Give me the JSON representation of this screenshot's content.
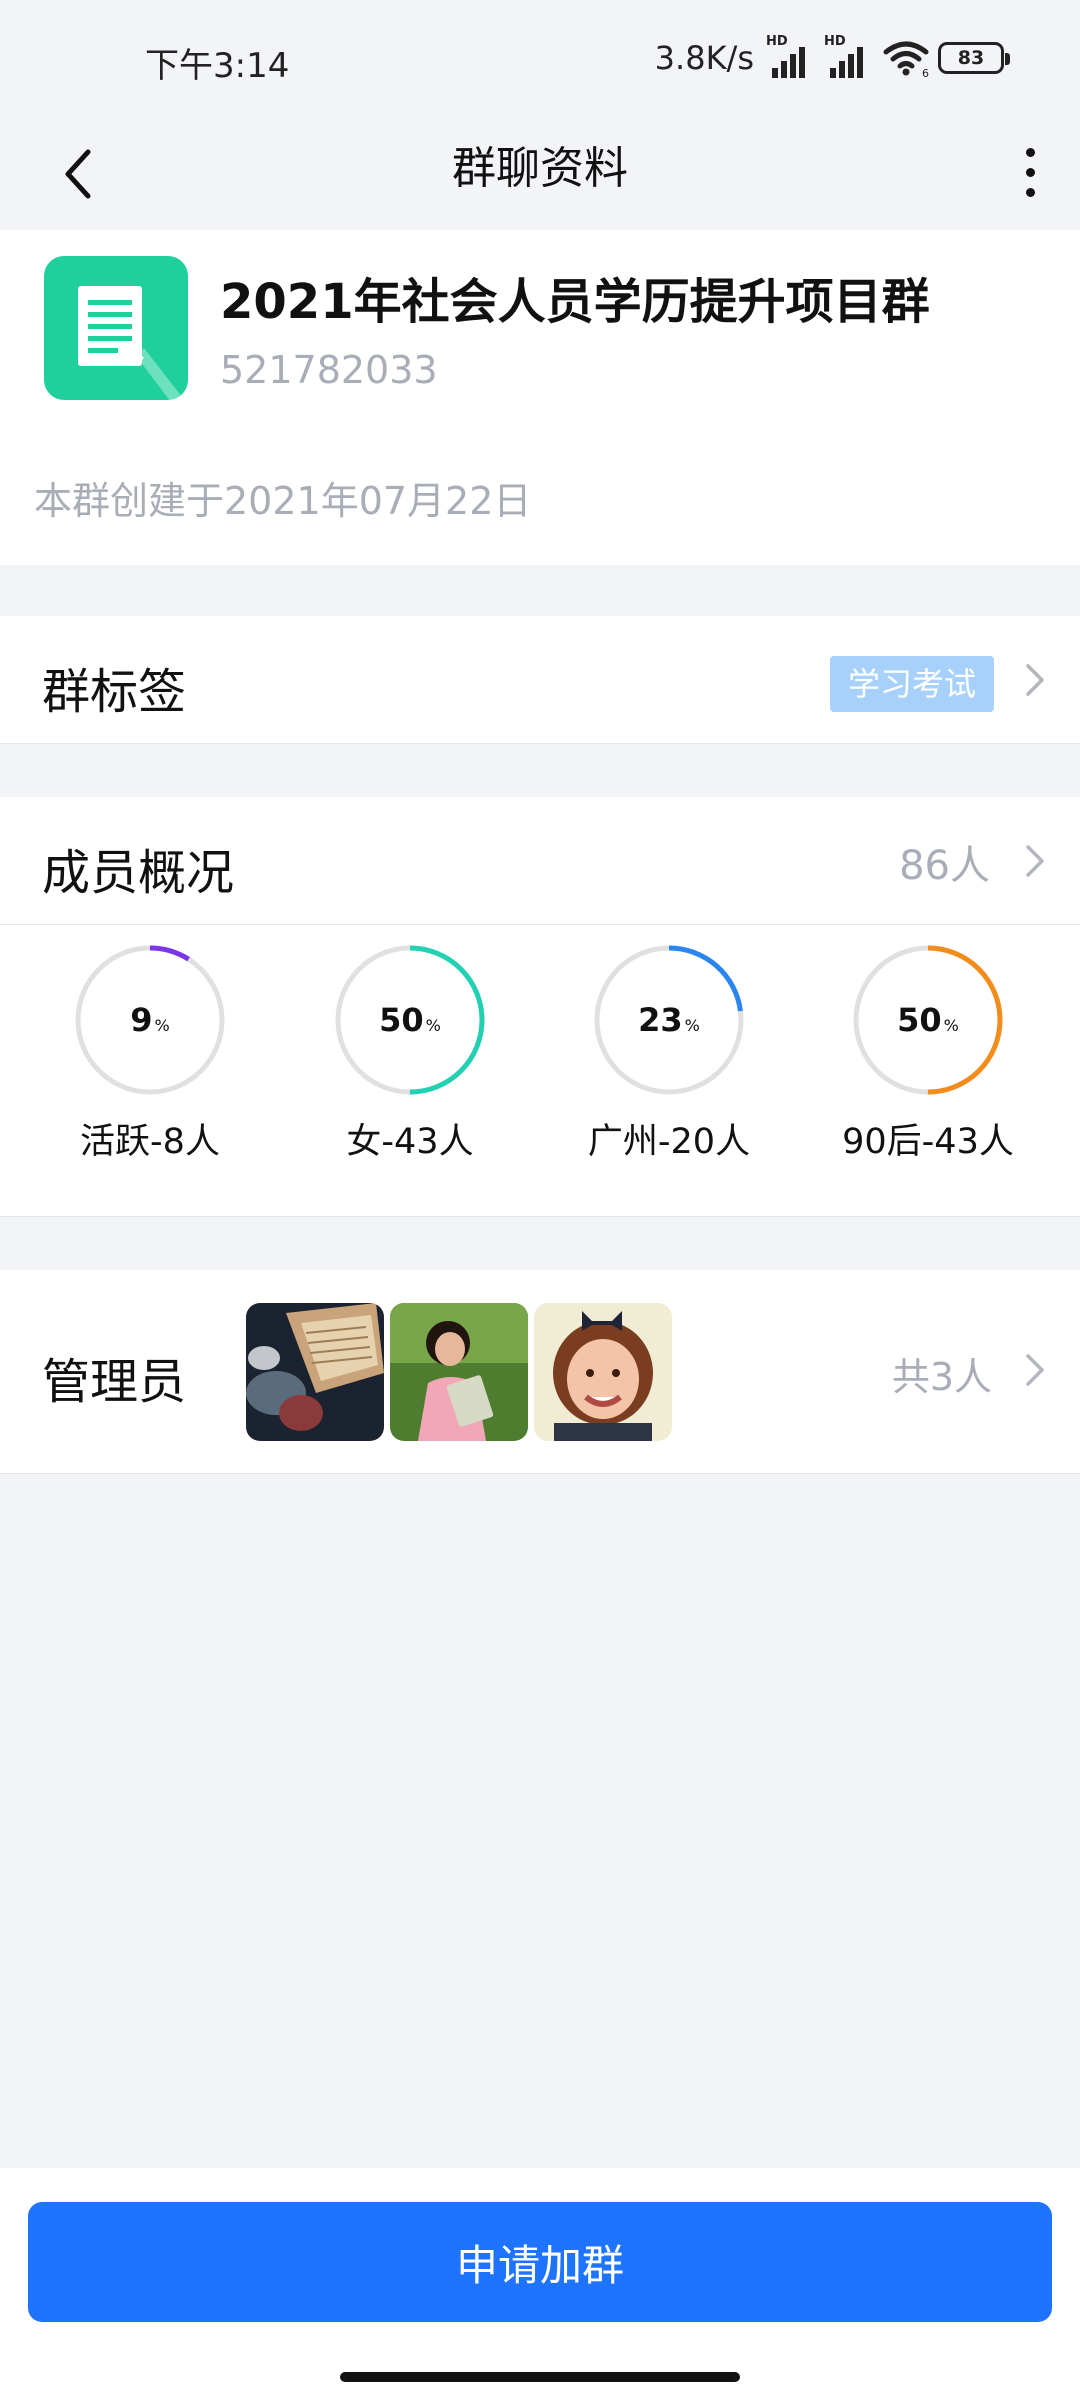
{
  "status_bar": {
    "time": "下午3:14",
    "net_speed": "3.8K/s",
    "signal_1_label": "HD",
    "signal_2_label": "HD",
    "wifi_badge": "6",
    "battery": "83"
  },
  "nav": {
    "title": "群聊资料",
    "back_icon": "chevron-left-icon",
    "more_icon": "more-vertical-icon"
  },
  "group": {
    "name": "2021年社会人员学历提升项目群",
    "id": "521782033",
    "created": "本群创建于2021年07月22日",
    "avatar_icon": "document-icon",
    "avatar_color": "#1fcf9c"
  },
  "tags": {
    "label": "群标签",
    "tag": "学习考试"
  },
  "members": {
    "label": "成员概况",
    "count": "86人",
    "stats": [
      {
        "value": "9",
        "unit": "%",
        "label": "活跃-8人",
        "percent": 9,
        "color": "#7b36e8"
      },
      {
        "value": "50",
        "unit": "%",
        "label": "女-43人",
        "percent": 50,
        "color": "#22d1b2"
      },
      {
        "value": "23",
        "unit": "%",
        "label": "广州-20人",
        "percent": 23,
        "color": "#2a86ee"
      },
      {
        "value": "50",
        "unit": "%",
        "label": "90后-43人",
        "percent": 50,
        "color": "#f28c1a"
      }
    ]
  },
  "admins": {
    "label": "管理员",
    "count": "共3人"
  },
  "actions": {
    "apply_label": "申请加群"
  }
}
